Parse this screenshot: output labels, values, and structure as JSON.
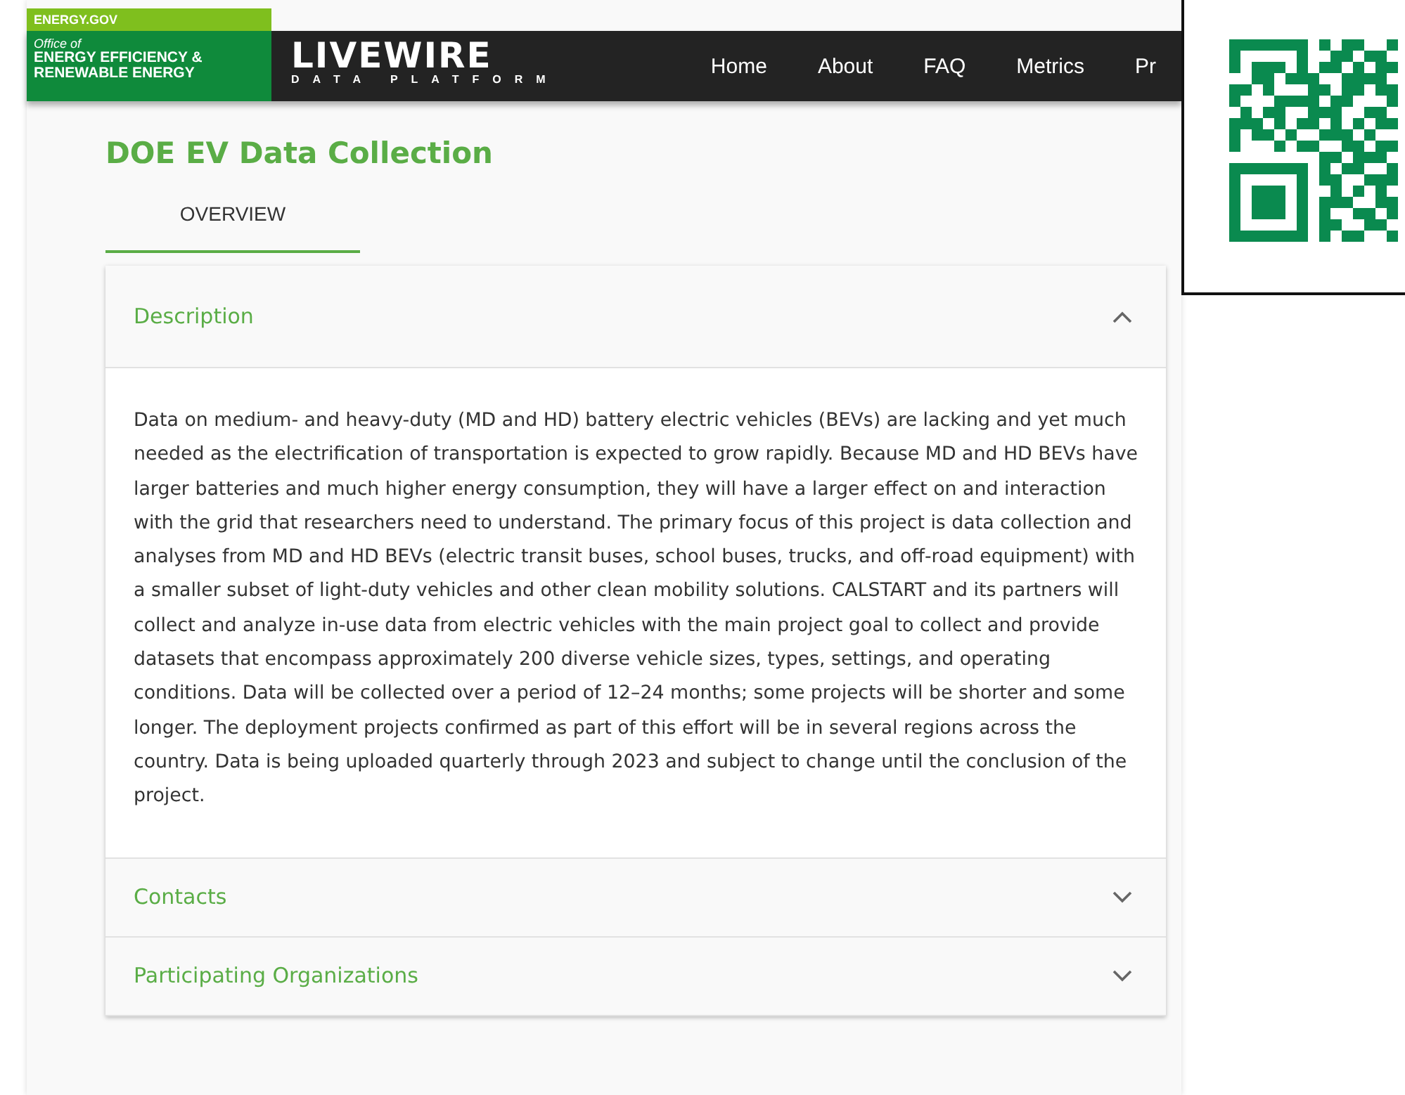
{
  "header": {
    "agency": "ENERGY.GOV",
    "office_prefix": "Office of",
    "office_name": [
      "ENERGY EFFICIENCY &",
      "RENEWABLE ENERGY"
    ],
    "logo": "LIVEWIRE",
    "logo_tagline": "DATA PLATFORM",
    "nav": [
      "Home",
      "About",
      "FAQ",
      "Metrics",
      "Pr"
    ]
  },
  "title": "DOE EV Data Collection",
  "tabs": [
    {
      "label": "OVERVIEW",
      "selected": true
    }
  ],
  "sections": [
    {
      "title": "Description",
      "expanded": true,
      "body": "Data on medium- and heavy-duty (MD and HD) battery electric vehicles (BEVs) are lacking and yet much needed as the electrification of transportation is expected to grow rapidly. Because MD and HD BEVs have larger batteries and much higher energy consumption, they will have a larger effect on and interaction with the grid that researchers need to understand. The primary focus of this project is data collection and analyses from MD and HD BEVs (electric transit buses, school buses, trucks, and off-road equipment) with a smaller subset of light-duty vehicles and other clean mobility solutions. CALSTART and its partners will collect and analyze in-use data from electric vehicles with the main project goal to collect and provide datasets that encompass approximately 200 diverse vehicle sizes, types, settings, and operating conditions. Data will be collected over a period of 12–24 months; some projects will be shorter and some longer. The deployment projects confirmed as part of this effort will be in several regions across the country. Data is being uploaded quarterly through 2023 and subject to change until the conclusion of the project."
    },
    {
      "title": "Contacts",
      "expanded": false
    },
    {
      "title": "Participating Organizations",
      "expanded": false
    }
  ]
}
